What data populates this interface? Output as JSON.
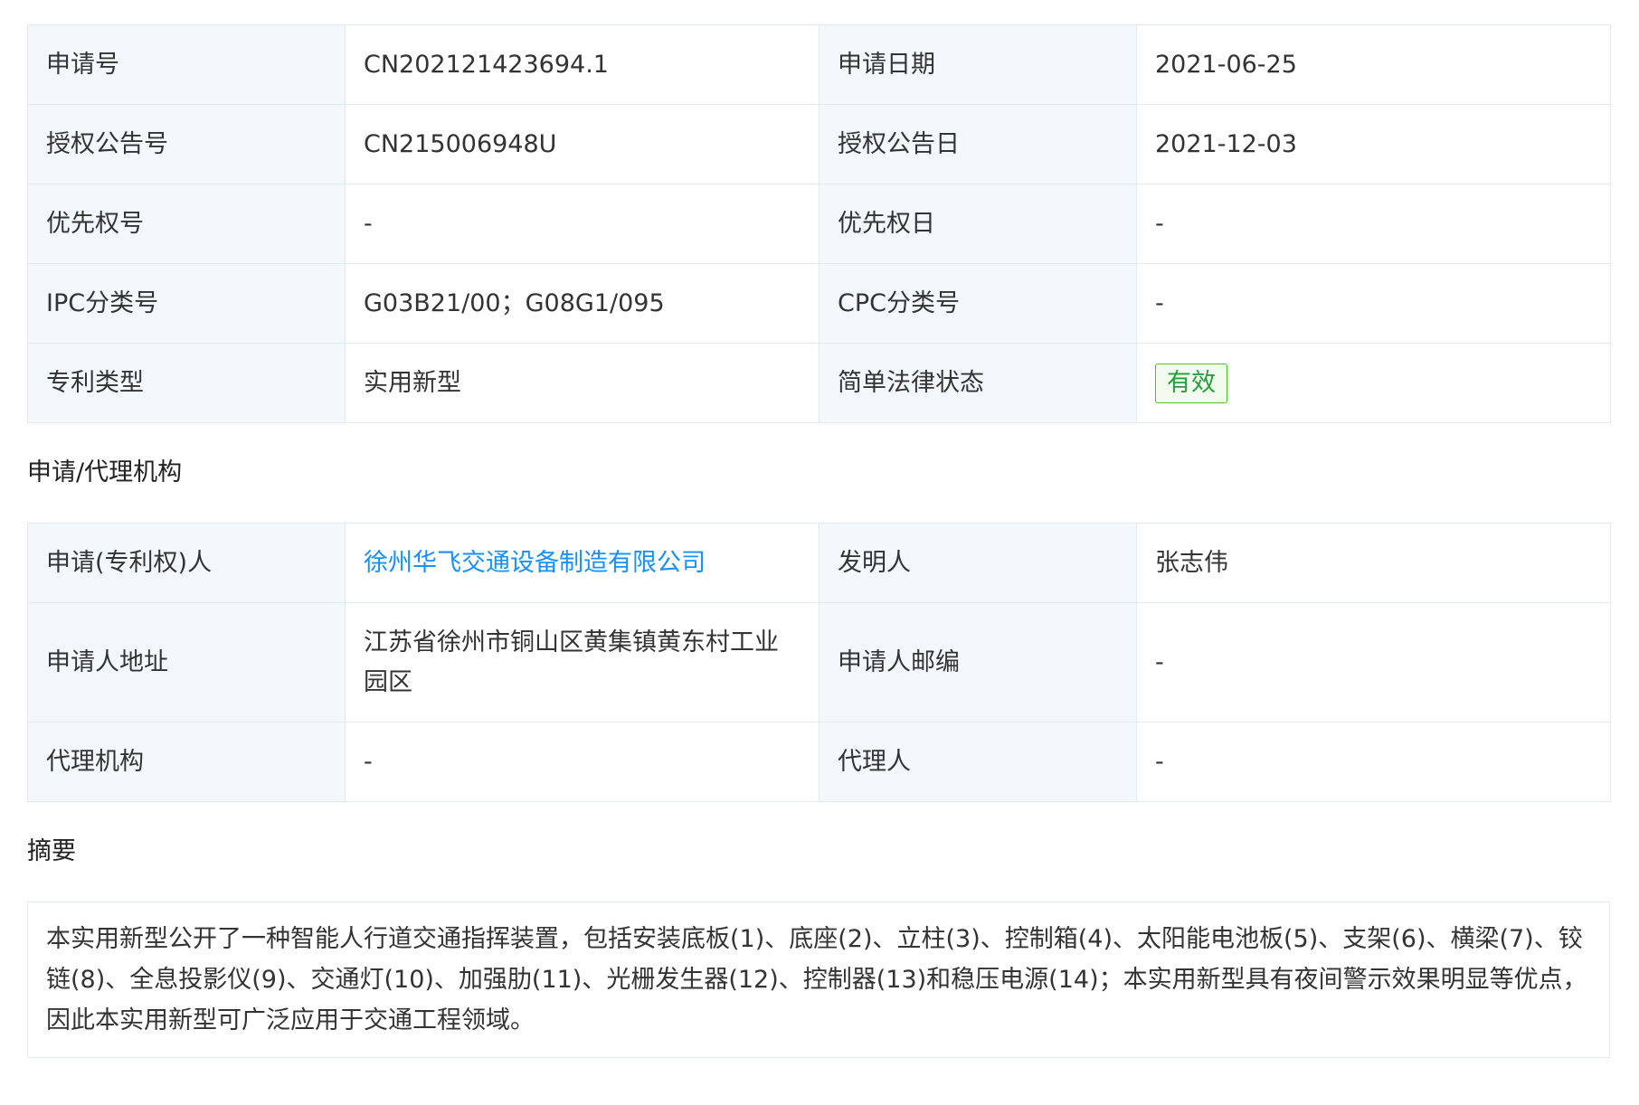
{
  "basic_info": {
    "rows": [
      {
        "l1": "申请号",
        "v1": "CN202121423694.1",
        "l2": "申请日期",
        "v2": "2021-06-25"
      },
      {
        "l1": "授权公告号",
        "v1": "CN215006948U",
        "l2": "授权公告日",
        "v2": "2021-12-03"
      },
      {
        "l1": "优先权号",
        "v1": "-",
        "l2": "优先权日",
        "v2": "-"
      },
      {
        "l1": "IPC分类号",
        "v1": "G03B21/00；G08G1/095",
        "l2": "CPC分类号",
        "v2": "-"
      },
      {
        "l1": "专利类型",
        "v1": "实用新型",
        "l2": "简单法律状态",
        "v2": "有效"
      }
    ],
    "status_color": "#23a03c"
  },
  "agency_section": {
    "title": "申请/代理机构",
    "rows": [
      {
        "l1": "申请(专利权)人",
        "v1": "徐州华飞交通设备制造有限公司",
        "l2": "发明人",
        "v2": "张志伟"
      },
      {
        "l1": "申请人地址",
        "v1": "江苏省徐州市铜山区黄集镇黄东村工业园区",
        "l2": "申请人邮编",
        "v2": "-"
      },
      {
        "l1": "代理机构",
        "v1": "-",
        "l2": "代理人",
        "v2": "-"
      }
    ],
    "link_color": "#1890ff"
  },
  "abstract_section": {
    "title": "摘要",
    "text": "本实用新型公开了一种智能人行道交通指挥装置，包括安装底板(1)、底座(2)、立柱(3)、控制箱(4)、太阳能电池板(5)、支架(6)、横梁(7)、铰链(8)、全息投影仪(9)、交通灯(10)、加强肋(11)、光栅发生器(12)、控制器(13)和稳压电源(14)；本实用新型具有夜间警示效果明显等优点，因此本实用新型可广泛应用于交通工程领域。"
  }
}
